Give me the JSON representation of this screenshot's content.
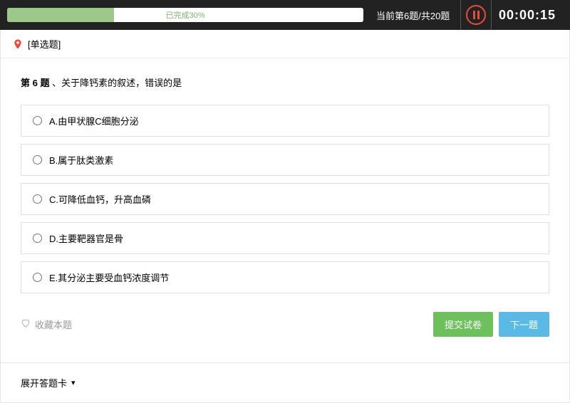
{
  "top": {
    "progress_pct": 30,
    "progress_label": "已完成30%",
    "position_text": "当前第6题/共20题",
    "timer": "00:00:15"
  },
  "question": {
    "type_label": "[单选题]",
    "number_label": "第 6 题",
    "sep": " 、",
    "stem": "关于降钙素的叙述，错误的是",
    "options": [
      {
        "key": "A",
        "text": "A.由甲状腺C细胞分泌"
      },
      {
        "key": "B",
        "text": "B.属于肽类激素"
      },
      {
        "key": "C",
        "text": "C.可降低血钙，升高血磷"
      },
      {
        "key": "D",
        "text": "D.主要靶器官是骨"
      },
      {
        "key": "E",
        "text": "E.其分泌主要受血钙浓度调节"
      }
    ]
  },
  "actions": {
    "favorite_label": "收藏本题",
    "submit_label": "提交试卷",
    "next_label": "下一题"
  },
  "expand": {
    "label": "展开答题卡"
  }
}
